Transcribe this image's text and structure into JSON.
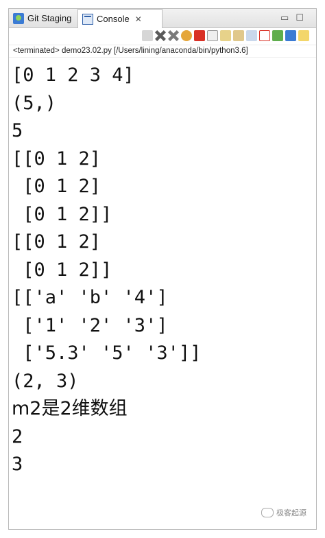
{
  "tabs": [
    {
      "label": "Git Staging",
      "icon": "git-staging-icon"
    },
    {
      "label": "Console",
      "icon": "console-icon",
      "active": true,
      "close": "✕"
    }
  ],
  "window_controls": {
    "minimize": "▭",
    "maximize": "☐"
  },
  "status": "<terminated> demo23.02.py [/Users/lining/anaconda/bin/python3.6]",
  "output_lines": [
    "[0 1 2 3 4]",
    "(5,)",
    "5",
    "[[0 1 2]",
    " [0 1 2]",
    " [0 1 2]]",
    "[[0 1 2]",
    " [0 1 2]]",
    "[['a' 'b' '4']",
    " ['1' '2' '3']",
    " ['5.3' '5' '3']]",
    "(2, 3)",
    "m2是2维数组",
    "2",
    "3"
  ],
  "watermark": "极客起源",
  "colors": {
    "accent": "#3b7bd4",
    "remove": "#d93025",
    "text": "#111111"
  }
}
